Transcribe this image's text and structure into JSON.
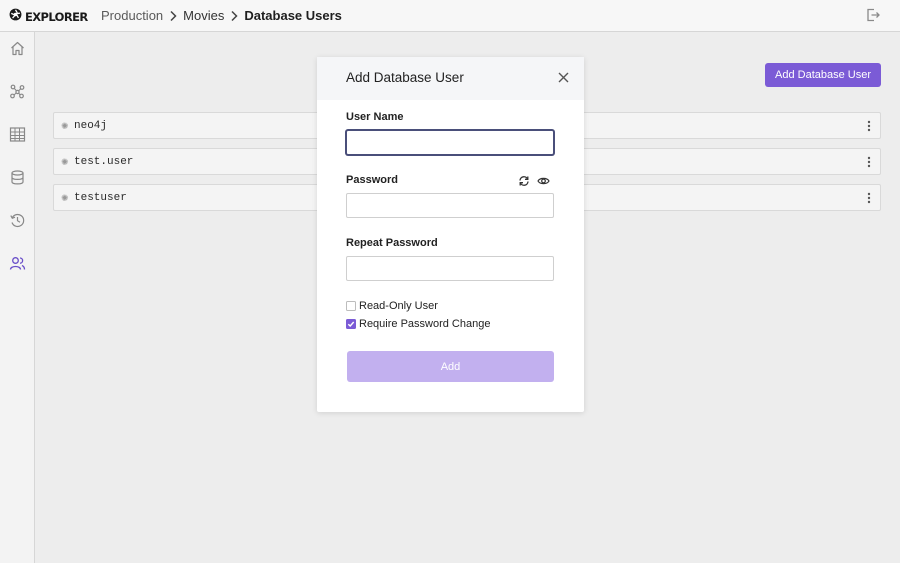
{
  "app": {
    "logo_text": "EXPLORER"
  },
  "breadcrumb": [
    {
      "label": "Production"
    },
    {
      "label": "Movies"
    },
    {
      "label": "Database Users"
    }
  ],
  "header": {
    "logout_icon": "logout-icon"
  },
  "sidebar": {
    "items": [
      {
        "icon": "home-icon",
        "active": false
      },
      {
        "icon": "graph-icon",
        "active": false
      },
      {
        "icon": "table-icon",
        "active": false
      },
      {
        "icon": "database-icon",
        "active": false
      },
      {
        "icon": "history-icon",
        "active": false
      },
      {
        "icon": "users-icon",
        "active": true
      }
    ]
  },
  "main": {
    "add_button_label": "Add Database User",
    "users": [
      {
        "name": "neo4j"
      },
      {
        "name": "test.user"
      },
      {
        "name": "testuser"
      }
    ]
  },
  "modal": {
    "title": "Add Database User",
    "username_label": "User Name",
    "username_value": "",
    "password_label": "Password",
    "password_value": "",
    "repeat_password_label": "Repeat Password",
    "repeat_password_value": "",
    "readonly_label": "Read-Only User",
    "readonly_checked": false,
    "require_change_label": "Require Password Change",
    "require_change_checked": true,
    "submit_label": "Add"
  },
  "colors": {
    "accent": "#7b5bd6",
    "accent_disabled": "#c2b0ef",
    "active_nav": "#6a4fc9"
  }
}
